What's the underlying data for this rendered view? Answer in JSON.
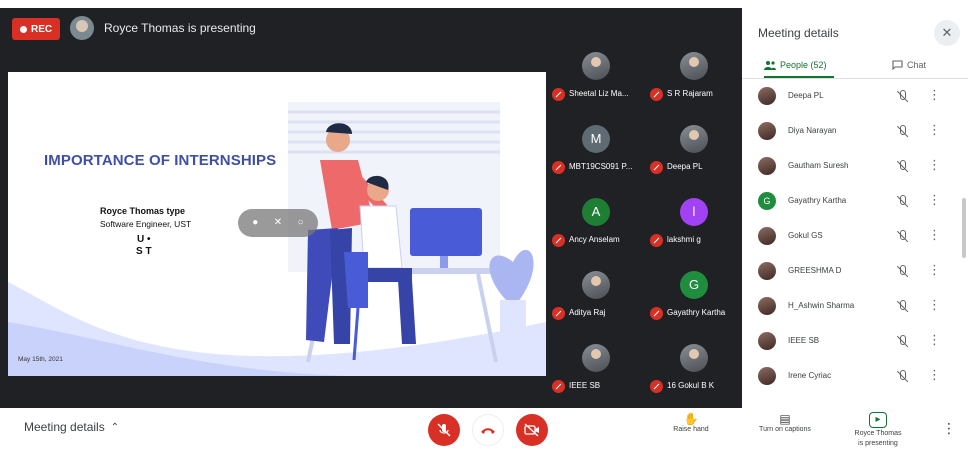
{
  "recording": {
    "label": "REC",
    "color": "#d93025"
  },
  "presenter": {
    "title": "Royce Thomas is presenting"
  },
  "slide": {
    "heading": "IMPORTANCE OF INTERNSHIPS",
    "presenter_name": "Royce Thomas type",
    "presenter_role": "Software Engineer, UST",
    "logo_line1": "U •",
    "logo_line2": "S T",
    "date": "May 15th, 2021",
    "heading_color": "#3f4fa6"
  },
  "tiles": [
    {
      "name": "Sheetal Liz Ma...",
      "avatar": "photo",
      "initial": "",
      "color": ""
    },
    {
      "name": "S R Rajaram",
      "avatar": "photo",
      "initial": "",
      "color": ""
    },
    {
      "name": "MBT19CS091 P...",
      "avatar": "letter",
      "initial": "M",
      "color": "#5f6b73"
    },
    {
      "name": "Deepa PL",
      "avatar": "photo",
      "initial": "",
      "color": ""
    },
    {
      "name": "Ancy Anselam",
      "avatar": "letter",
      "initial": "A",
      "color": "#1e7e34"
    },
    {
      "name": "lakshmi g",
      "avatar": "letter",
      "initial": "l",
      "color": "#a142f4"
    },
    {
      "name": "Aditya Raj",
      "avatar": "photo",
      "initial": "",
      "color": ""
    },
    {
      "name": "Gayathry Kartha",
      "avatar": "letter",
      "initial": "G",
      "color": "#1e8e3e"
    },
    {
      "name": "IEEE SB",
      "avatar": "photo",
      "initial": "",
      "color": ""
    },
    {
      "name": "16 Gokul B K",
      "avatar": "photo",
      "initial": "",
      "color": ""
    }
  ],
  "panel": {
    "title": "Meeting details",
    "close_icon": "✕",
    "tab_people": "People (52)",
    "tab_chat": "Chat",
    "accent": "#137333",
    "people": [
      {
        "name": "Deepa PL",
        "avatar": "photo",
        "initial": "",
        "color": ""
      },
      {
        "name": "Diya Narayan",
        "avatar": "photo",
        "initial": "",
        "color": ""
      },
      {
        "name": "Gautham Suresh",
        "avatar": "photo",
        "initial": "",
        "color": ""
      },
      {
        "name": "Gayathry Kartha",
        "avatar": "letter",
        "initial": "G",
        "color": "#1e8e3e"
      },
      {
        "name": "Gokul GS",
        "avatar": "photo",
        "initial": "",
        "color": ""
      },
      {
        "name": "GREESHMA D",
        "avatar": "photo",
        "initial": "",
        "color": ""
      },
      {
        "name": "H_Ashwin Sharma",
        "avatar": "photo",
        "initial": "",
        "color": ""
      },
      {
        "name": "IEEE SB",
        "avatar": "photo",
        "initial": "",
        "color": ""
      },
      {
        "name": "Irene Cyriac",
        "avatar": "photo",
        "initial": "",
        "color": ""
      }
    ]
  },
  "bottom": {
    "meeting_details": "Meeting details",
    "raise_hand": "Raise hand",
    "captions": "Turn on captions",
    "presenting_line1": "Royce Thomas",
    "presenting_line2": "is presenting"
  }
}
